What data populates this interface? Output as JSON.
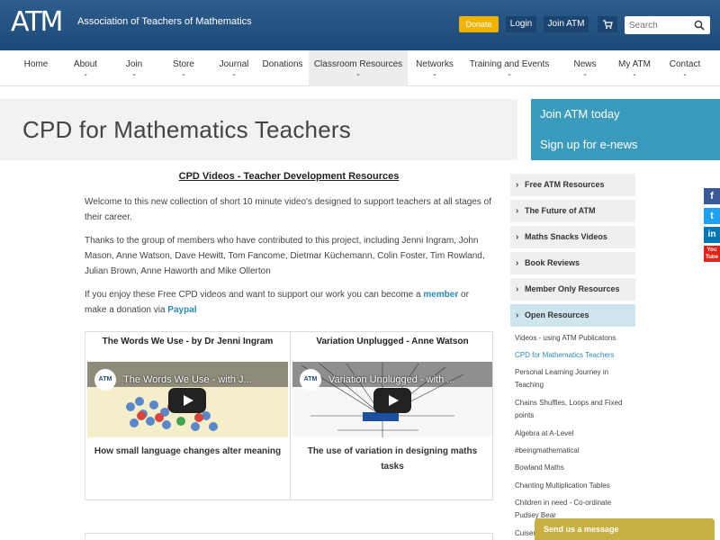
{
  "header": {
    "logo_text": "ATM",
    "org_name": "Association of Teachers of Mathematics",
    "donate_label": "Donate",
    "login_label": "Login",
    "join_label": "Join ATM",
    "cart_icon": "cart-icon",
    "search_placeholder": "Search",
    "accent_color": "#f0b400"
  },
  "nav": {
    "items": [
      {
        "label": "Home",
        "has_menu": false
      },
      {
        "label": "About",
        "has_menu": true
      },
      {
        "label": "Join",
        "has_menu": true
      },
      {
        "label": "Store",
        "has_menu": true
      },
      {
        "label": "Journal",
        "has_menu": true
      },
      {
        "label": "Donations",
        "has_menu": false
      },
      {
        "label": "Classroom Resources",
        "has_menu": true
      },
      {
        "label": "Networks",
        "has_menu": true
      },
      {
        "label": "Training and Events",
        "has_menu": true
      },
      {
        "label": "News",
        "has_menu": true
      },
      {
        "label": "My ATM",
        "has_menu": true
      },
      {
        "label": "Contact",
        "has_menu": true
      }
    ],
    "chevron": "⌄"
  },
  "page": {
    "title": "CPD for Mathematics Teachers",
    "promo_join": "Join ATM today",
    "promo_signup": "Sign up for e-news",
    "promo_color": "#3b9bbd"
  },
  "main": {
    "heading": "CPD Videos - Teacher Development Resources",
    "para1": "Welcome to this new collection of short 10 minute video's designed to support teachers at all stages of their career.",
    "para2": "Thanks to the group of members who have contributed to this project, including Jenni Ingram, John Mason, Anne Watson, Dave Hewitt, Tom Fancome,  Dietmar Küchemann, Colin Foster, Tim Rowland, Julian Brown, Anne Haworth and Mike Ollerton",
    "para3_before": "If you enjoy these Free CPD videos and want to support our work you can become a ",
    "para3_member": "member",
    "para3_middle": " or make a donation via ",
    "para3_paypal": "Paypal",
    "videos": [
      {
        "title": "The Words We Use - by Dr Jenni Ingram",
        "video_title": "The Words We Use - with J...",
        "logo": "ATM",
        "caption": "How small language changes alter meaning"
      },
      {
        "title": "Variation Unplugged - Anne Watson",
        "video_title": "Variation Unplugged - with ...",
        "logo": "ATM",
        "caption": "The use of variation in designing maths tasks"
      }
    ]
  },
  "sidebar": {
    "sections": [
      "Free ATM Resources",
      "The Future of ATM",
      "Maths Snacks Videos",
      "Book Reviews",
      "Member Only Resources",
      "Open Resources"
    ],
    "links": [
      "Videos - using ATM Publicatons",
      "CPD for Mathematics Teachers",
      "Personal Learning Journey in Teaching",
      "Chains Shuffles, Loops and Fixed points",
      "Algebra at A-Level",
      "#beingmathematical",
      "Bowland Maths",
      "Chanting Multiplication Tables",
      "Children in need - Co-ordinate Pudsey Bear",
      "Cuisenaire"
    ],
    "active_link_color": "#2b8bb5"
  },
  "social": {
    "facebook": "f",
    "twitter": "t",
    "linkedin": "in",
    "youtube": "You Tube"
  },
  "chat": {
    "label": "Send us a message"
  }
}
